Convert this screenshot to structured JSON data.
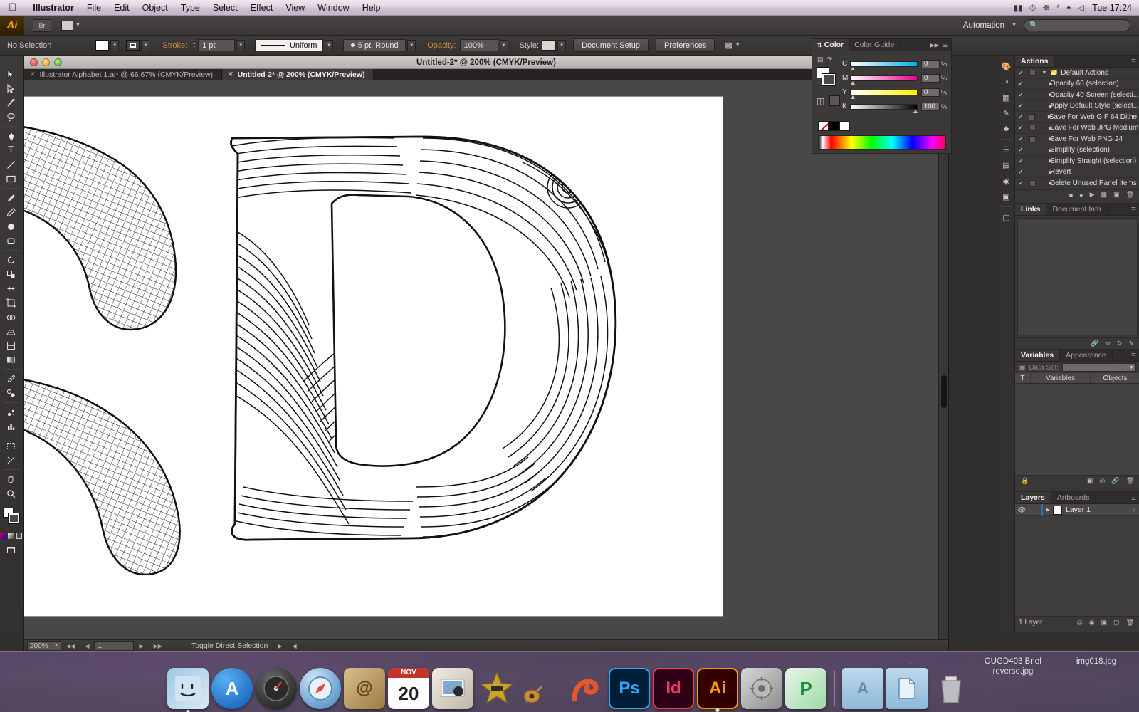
{
  "menubar": {
    "apple": "apple-logo",
    "items": [
      "Illustrator",
      "File",
      "Edit",
      "Object",
      "Type",
      "Select",
      "Effect",
      "View",
      "Window",
      "Help"
    ],
    "right_icons": [
      "flag-icon",
      "clock-icon",
      "spotlight-binoculars-icon",
      "bluetooth-icon",
      "wifi-icon",
      "volume-icon"
    ],
    "clock": "Tue 17:24"
  },
  "controlbar": {
    "selection_status": "No Selection",
    "fill_label": "fill-swatch",
    "stroke_swatch_label": "stroke-swatch",
    "stroke_label": "Stroke:",
    "stroke_weight": "1 pt",
    "stroke_profile": "Uniform",
    "stroke_cap": "5 pt. Round",
    "opacity_label": "Opacity:",
    "opacity_value": "100%",
    "style_label": "Style:",
    "document_setup": "Document Setup",
    "preferences": "Preferences"
  },
  "automation": {
    "label": "Automation",
    "search_placeholder": ""
  },
  "document": {
    "window_title": "Untitled-2* @ 200% (CMYK/Preview)",
    "tabs": [
      {
        "label": "Illustrator Alphabet 1.ai* @ 66.67% (CMYK/Preview)",
        "active": false
      },
      {
        "label": "Untitled-2* @ 200% (CMYK/Preview)",
        "active": true
      }
    ]
  },
  "statusbar": {
    "zoom": "200%",
    "page": "1",
    "tool_status": "Toggle Direct Selection"
  },
  "toolbar": {
    "tools": [
      "selection-tool",
      "direct-selection-tool",
      "magic-wand-tool",
      "lasso-tool",
      "pen-tool",
      "type-tool",
      "line-segment-tool",
      "rectangle-tool",
      "paintbrush-tool",
      "pencil-tool",
      "blob-brush-tool",
      "eraser-tool",
      "rotate-tool",
      "scale-tool",
      "width-tool",
      "free-transform-tool",
      "shape-builder-tool",
      "perspective-grid-tool",
      "mesh-tool",
      "gradient-tool",
      "eyedropper-tool",
      "blend-tool",
      "symbol-sprayer-tool",
      "column-graph-tool",
      "artboard-tool",
      "slice-tool",
      "hand-tool",
      "zoom-tool",
      "fill-stroke-swatches",
      "color-mode-buttons",
      "screen-mode-button"
    ]
  },
  "panels": {
    "color": {
      "tabs": [
        "Color",
        "Color Guide"
      ],
      "active_tab": "Color",
      "sliders": [
        {
          "letter": "C",
          "value": "0",
          "unit": "%"
        },
        {
          "letter": "M",
          "value": "0",
          "unit": "%"
        },
        {
          "letter": "Y",
          "value": "0",
          "unit": "%"
        },
        {
          "letter": "K",
          "value": "100",
          "unit": "%"
        }
      ],
      "fill_color": "#ffffff",
      "stroke_color": "#000000"
    },
    "actions": {
      "tab": "Actions",
      "rows": [
        {
          "label": "Default Actions",
          "type": "folder",
          "expanded": true,
          "checked": true,
          "has_box": true
        },
        {
          "label": "Opacity 60 (selection)",
          "type": "action",
          "checked": true,
          "has_box": false
        },
        {
          "label": "Opacity 40 Screen (selecti...",
          "type": "action",
          "checked": true,
          "has_box": false
        },
        {
          "label": "Apply Default Style (select...",
          "type": "action",
          "checked": true,
          "has_box": false
        },
        {
          "label": "Save For Web GIF 64 Dithe...",
          "type": "action",
          "checked": true,
          "has_box": true
        },
        {
          "label": "Save For Web JPG Medium",
          "type": "action",
          "checked": true,
          "has_box": true
        },
        {
          "label": "Save For Web PNG 24",
          "type": "action",
          "checked": true,
          "has_box": true
        },
        {
          "label": "Simplify (selection)",
          "type": "action",
          "checked": true,
          "has_box": false
        },
        {
          "label": "Simplify Straight (selection)",
          "type": "action",
          "checked": true,
          "has_box": false
        },
        {
          "label": "Revert",
          "type": "action",
          "checked": true,
          "has_box": false
        },
        {
          "label": "Delete Unused Panel Items",
          "type": "action",
          "checked": true,
          "has_box": true
        }
      ],
      "footer_icons": [
        "stop-icon",
        "record-icon",
        "play-icon",
        "new-set-icon",
        "new-action-icon",
        "delete-icon"
      ]
    },
    "links": {
      "tabs": [
        "Links",
        "Document Info"
      ],
      "active_tab": "Links",
      "footer_icons": [
        "relink-icon",
        "goto-link-icon",
        "update-link-icon",
        "edit-original-icon"
      ]
    },
    "variables": {
      "tabs": [
        "Variables",
        "Appearance"
      ],
      "active_tab": "Variables",
      "dataset_label": "Data Set:",
      "dataset_value": "",
      "columns": [
        "T",
        "Variables",
        "Objects"
      ],
      "footer_icons": [
        "lock-icon",
        "make-object-dynamic-icon",
        "make-visibility-dynamic-icon",
        "unbind-variable-icon",
        "delete-variable-icon"
      ]
    },
    "layers": {
      "tabs": [
        "Layers",
        "Artboards"
      ],
      "active_tab": "Layers",
      "rows": [
        {
          "name": "Layer 1",
          "visible": true,
          "selected": true,
          "color": "#ffffff"
        }
      ],
      "count_label": "1 Layer",
      "footer_icons": [
        "locate-object-icon",
        "make-clipping-mask-icon",
        "create-sublayer-icon",
        "new-layer-icon",
        "delete-layer-icon"
      ]
    },
    "dock_icons": [
      "color-panel-icon",
      "color-guide-icon",
      "swatches-icon",
      "brushes-icon",
      "symbols-icon",
      "stroke-icon",
      "gradient-icon",
      "transparency-icon",
      "appearance-icon",
      "graphic-styles-icon"
    ]
  },
  "artwork": {
    "title": "decorative-letter-d",
    "description": "Hand-drawn decorative letter D filled with concentric and parallel line patterns",
    "secondary": "partial-letter-c-crosshatch"
  },
  "desktop": {
    "files": [
      {
        "label_line1": "OUGD403 Brief",
        "label_line2": "reverse.jpg"
      },
      {
        "label_line1": "img018.jpg",
        "label_line2": ""
      }
    ]
  },
  "dock": {
    "items": [
      {
        "name": "finder",
        "glyph": "",
        "color": "#5a9fd4"
      },
      {
        "name": "app-store",
        "glyph": "A",
        "color": "#1f7ae0"
      },
      {
        "name": "dashboard",
        "glyph": "",
        "color": "#2b2b2b"
      },
      {
        "name": "safari",
        "glyph": "",
        "color": "#4a90d9"
      },
      {
        "name": "address-book",
        "glyph": "@",
        "color": "#c6a869"
      },
      {
        "name": "calendar",
        "glyph": "20",
        "color": "#f2f2f2",
        "month": "NOV"
      },
      {
        "name": "iphoto",
        "glyph": "",
        "color": "#d8d8d8"
      },
      {
        "name": "imovie",
        "glyph": "",
        "color": "#b8912e"
      },
      {
        "name": "garageband",
        "glyph": "",
        "color": "#8a5a2b"
      },
      {
        "name": "preview",
        "glyph": "",
        "color": "#e4572e"
      },
      {
        "name": "photoshop",
        "glyph": "Ps",
        "color": "#001e36",
        "accent": "#31a8ff"
      },
      {
        "name": "indesign",
        "glyph": "Id",
        "color": "#2d0016",
        "accent": "#ff3366"
      },
      {
        "name": "illustrator",
        "glyph": "Ai",
        "color": "#330000",
        "accent": "#ff9a00"
      },
      {
        "name": "system-preferences",
        "glyph": "",
        "color": "#9a9a9a"
      },
      {
        "name": "powerpoint",
        "glyph": "P",
        "color": "#2bb24c"
      },
      {
        "name": "applications-folder",
        "glyph": "A",
        "color": "#8fb8d8"
      },
      {
        "name": "documents-folder",
        "glyph": "",
        "color": "#8fb8d8"
      },
      {
        "name": "trash",
        "glyph": "",
        "color": "#cfcfcf"
      }
    ]
  }
}
